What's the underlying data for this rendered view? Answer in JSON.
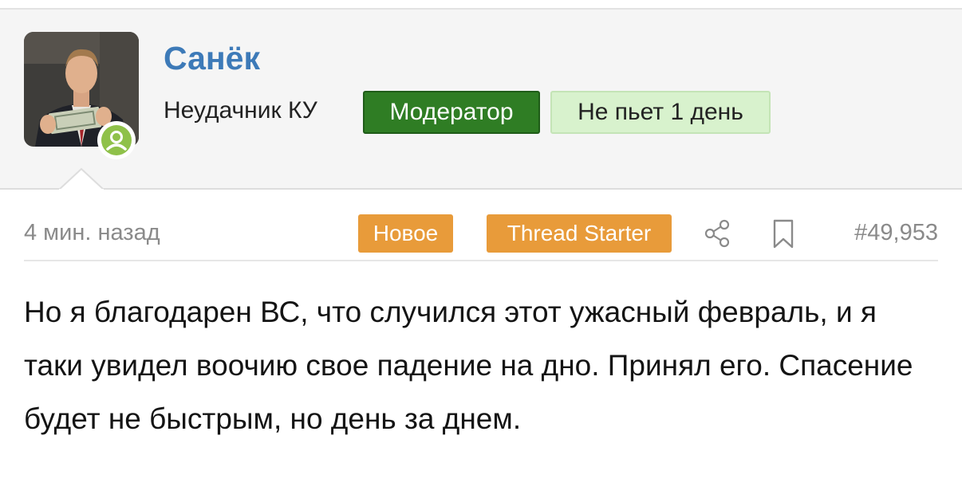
{
  "user": {
    "name": "Санёк",
    "title": "Неудачник КУ",
    "badges": {
      "moderator": "Модератор",
      "sobriety": "Не пьет 1 день"
    },
    "avatar_icon": "avatar-photo",
    "status_icon": "user-online-icon"
  },
  "post": {
    "time": "4 мин. назад",
    "tag_new": "Новое",
    "tag_starter": "Thread Starter",
    "share_icon": "share-icon",
    "bookmark_icon": "bookmark-icon",
    "number": "#49,953",
    "body": "Но я благодарен ВС, что случился этот ужасный февраль, и я таки увидел воочию свое падение на дно. Принял его. Спасение будет не быстрым, но день за днем."
  },
  "colors": {
    "username": "#3d7ab8",
    "moderator_badge": "#2f7d24",
    "sobriety_badge": "#d8f2cd",
    "tag": "#e89b3a",
    "online": "#8fc14a"
  }
}
